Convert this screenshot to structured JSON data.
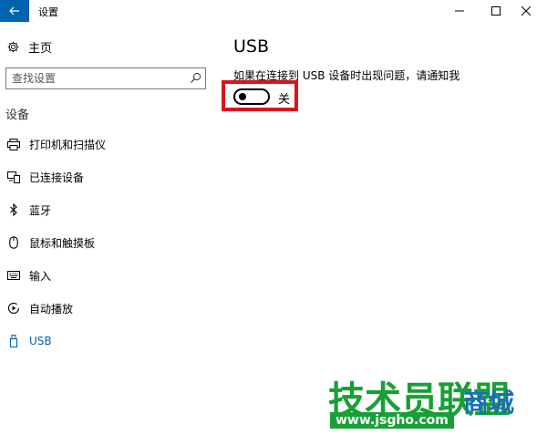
{
  "window": {
    "title": "设置"
  },
  "sidebar": {
    "home_label": "主页",
    "search_placeholder": "查找设置",
    "section_label": "设备",
    "items": [
      {
        "label": "打印机和扫描仪",
        "icon": "printer-icon"
      },
      {
        "label": "已连接设备",
        "icon": "connected-devices-icon"
      },
      {
        "label": "蓝牙",
        "icon": "bluetooth-icon"
      },
      {
        "label": "鼠标和触摸板",
        "icon": "mouse-icon"
      },
      {
        "label": "输入",
        "icon": "keyboard-icon"
      },
      {
        "label": "自动播放",
        "icon": "autoplay-icon"
      },
      {
        "label": "USB",
        "icon": "usb-icon",
        "active": true
      }
    ]
  },
  "main": {
    "title": "USB",
    "description": "如果在连接到 USB 设备时出现问题，请通知我",
    "toggle_state": "关",
    "toggle_on": false
  },
  "watermark": {
    "text": "技术员联盟",
    "text2": "商城",
    "url": "www.jsgho.com"
  },
  "colors": {
    "accent": "#0063b1",
    "highlight_border": "#d8141c",
    "watermark_green": "#17a035"
  }
}
